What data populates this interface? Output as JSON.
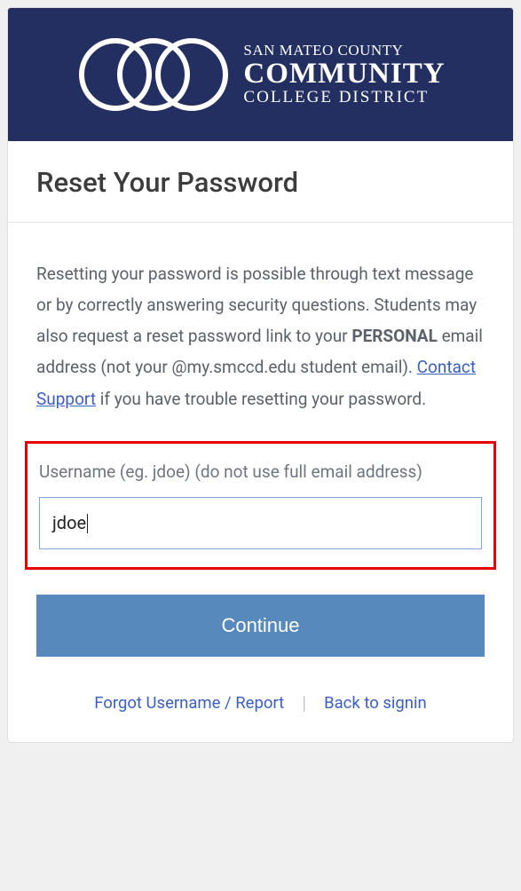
{
  "header": {
    "org_line1": "SAN MATEO COUNTY",
    "org_line2": "COMMUNITY",
    "org_line3": "COLLEGE DISTRICT"
  },
  "page": {
    "title": "Reset Your Password",
    "intro_part1": "Resetting your password is possible through text message or by correctly answering security questions. Students may also request a reset password link to your ",
    "intro_bold": "PERSONAL",
    "intro_part2": " email address (not your @my.smccd.edu student email). ",
    "contact_link": "Contact Support",
    "intro_part3": " if you have trouble resetting your password."
  },
  "form": {
    "username_label": "Username (eg. jdoe) (do not use full email address)",
    "username_value": "jdoe",
    "continue_label": "Continue"
  },
  "footer": {
    "forgot_link": "Forgot Username / Report",
    "signin_link": "Back to signin"
  },
  "colors": {
    "header_bg": "#232f61",
    "accent_red": "#e60000",
    "button_bg": "#5889bd",
    "link": "#3b5fbf"
  }
}
